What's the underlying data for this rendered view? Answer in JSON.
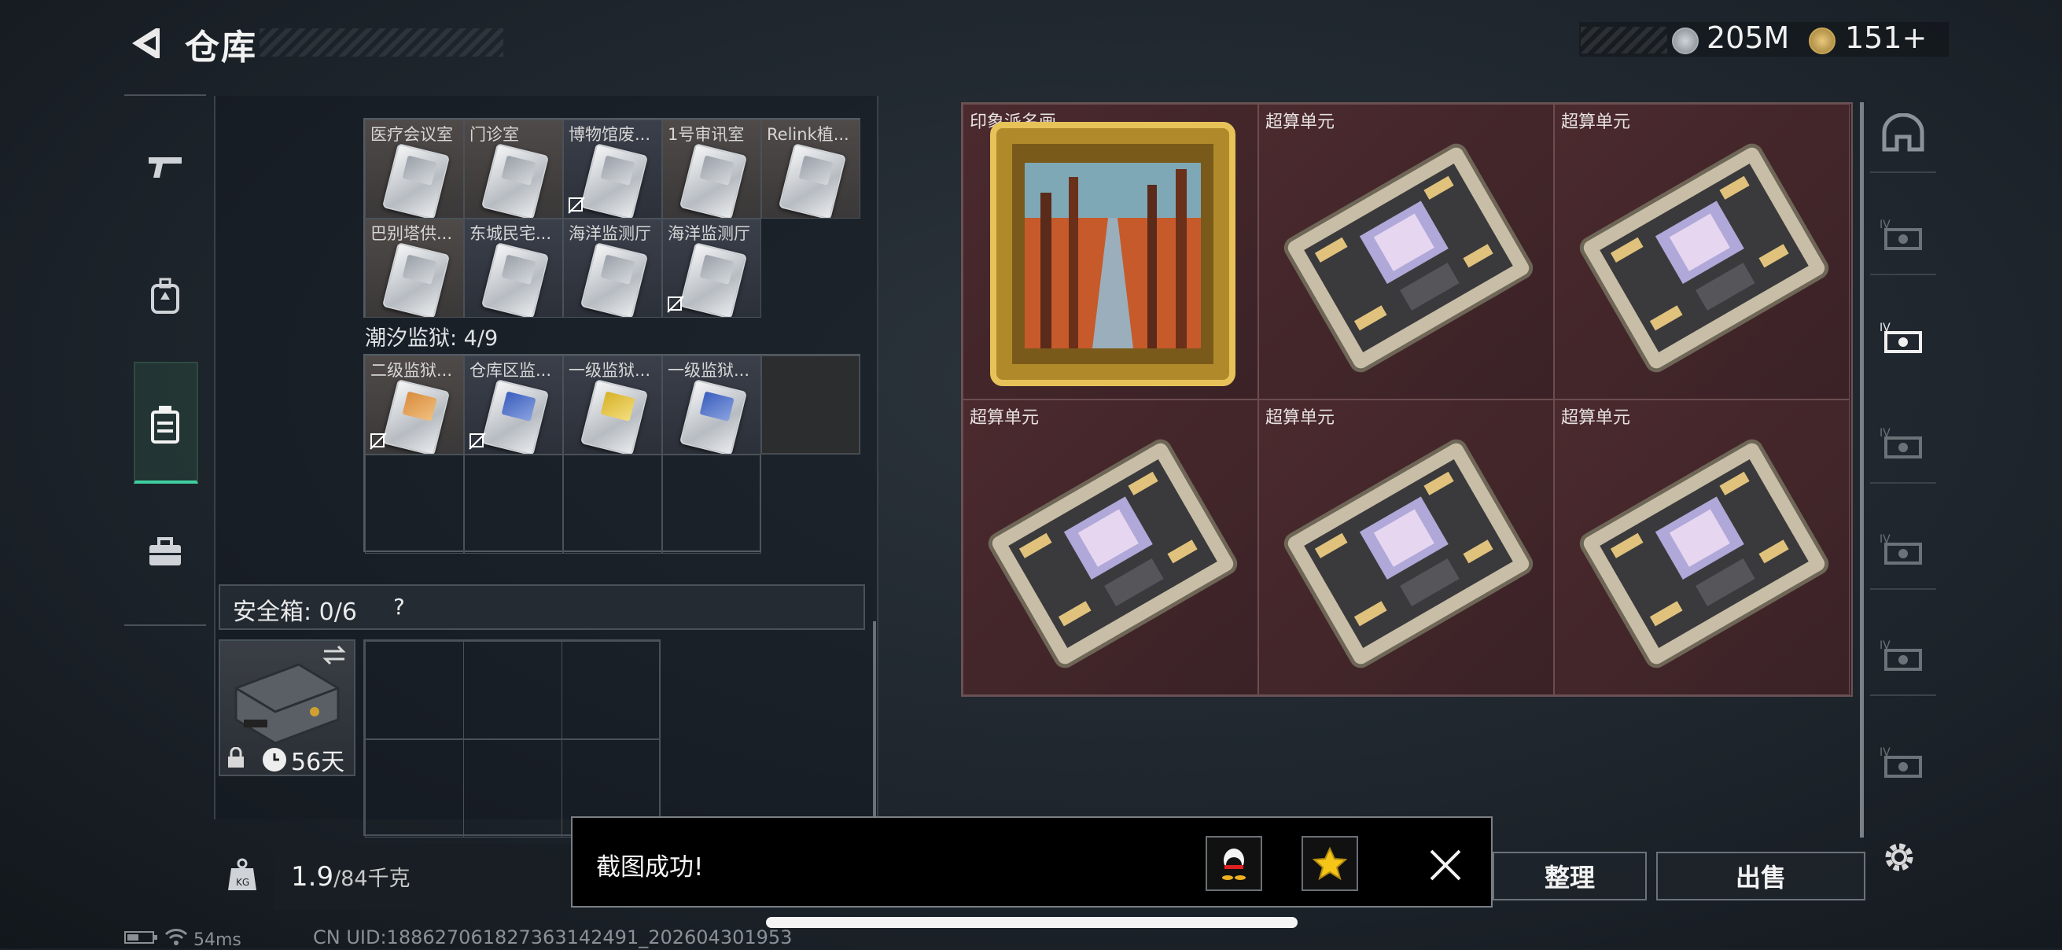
{
  "header": {
    "title": "仓库",
    "coin1": "205M",
    "coin2": "151+"
  },
  "left_nav": {
    "items": [
      "weapon-icon",
      "backpack-icon",
      "rig-icon",
      "toolbox-icon"
    ],
    "selected": "rig-icon"
  },
  "section1": {
    "row1": [
      "医疗会议室",
      "门诊室",
      "博物馆废...",
      "1号审讯室",
      "Relink植..."
    ],
    "row2": [
      "巴别塔供...",
      "东城民宅...",
      "海洋监测厅",
      "海洋监测厅"
    ]
  },
  "section2": {
    "title": "潮汐监狱: 4/9",
    "row1": [
      "二级监狱...",
      "仓库区监...",
      "一级监狱...",
      "一级监狱..."
    ]
  },
  "safebox": {
    "label": "安全箱: 0/6",
    "help": "?",
    "days": "56天"
  },
  "weight": {
    "value": "1.9",
    "unit": "/84千克"
  },
  "right_grid": {
    "cells": [
      "印象派名画",
      "超算单元",
      "超算单元",
      "超算单元",
      "超算单元",
      "超算单元"
    ]
  },
  "right_nav": {
    "items": [
      "helmet-icon",
      "armor-iv-icon",
      "armor-iv-icon",
      "armor-iv-icon",
      "armor-iv-icon",
      "armor-iv-icon",
      "armor-iv-icon"
    ],
    "selected_index": 2
  },
  "buttons": {
    "organize": "整理",
    "sell": "出售"
  },
  "toast": {
    "text": "截图成功!"
  },
  "status": {
    "ping": "54ms",
    "uid": "CN UID:18862706182736314249​1_202604301953"
  }
}
